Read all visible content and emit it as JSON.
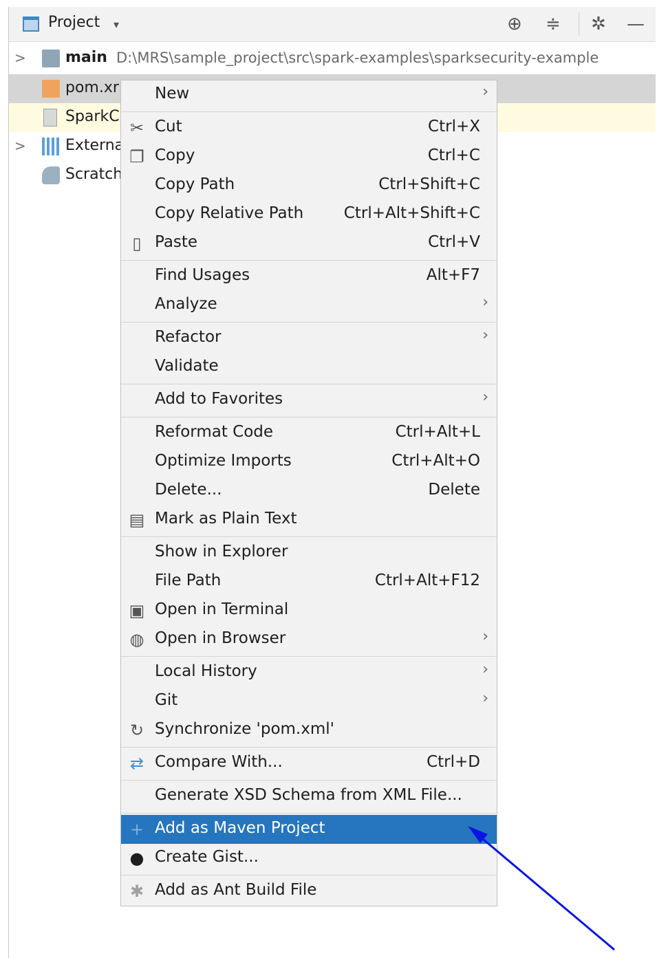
{
  "panel": {
    "title": "Project",
    "caret": "▾",
    "icons": [
      "target-icon",
      "collapse-all-icon",
      "gear-icon",
      "minimize-icon"
    ]
  },
  "tree": {
    "main": {
      "label": "main",
      "path": "D:\\MRS\\sample_project\\src\\spark-examples\\sparksecurity-example"
    },
    "pom": {
      "label": "pom.xr"
    },
    "spark": {
      "label": "SparkC"
    },
    "external": {
      "label": "Externa"
    },
    "scratch": {
      "label": "Scratch"
    }
  },
  "menu": {
    "items": [
      {
        "label": "New",
        "shortcut": "",
        "submenu": true,
        "icon": ""
      },
      {
        "label": "Cut",
        "shortcut": "Ctrl+X",
        "submenu": false,
        "icon": "scissors-icon"
      },
      {
        "label": "Copy",
        "shortcut": "Ctrl+C",
        "submenu": false,
        "icon": "copy-icon"
      },
      {
        "label": "Copy Path",
        "shortcut": "Ctrl+Shift+C",
        "submenu": false,
        "icon": ""
      },
      {
        "label": "Copy Relative Path",
        "shortcut": "Ctrl+Alt+Shift+C",
        "submenu": false,
        "icon": ""
      },
      {
        "label": "Paste",
        "shortcut": "Ctrl+V",
        "submenu": false,
        "icon": "clipboard-icon"
      },
      {
        "label": "Find Usages",
        "shortcut": "Alt+F7",
        "submenu": false,
        "icon": ""
      },
      {
        "label": "Analyze",
        "shortcut": "",
        "submenu": true,
        "icon": ""
      },
      {
        "label": "Refactor",
        "shortcut": "",
        "submenu": true,
        "icon": ""
      },
      {
        "label": "Validate",
        "shortcut": "",
        "submenu": false,
        "icon": ""
      },
      {
        "label": "Add to Favorites",
        "shortcut": "",
        "submenu": true,
        "icon": ""
      },
      {
        "label": "Reformat Code",
        "shortcut": "Ctrl+Alt+L",
        "submenu": false,
        "icon": ""
      },
      {
        "label": "Optimize Imports",
        "shortcut": "Ctrl+Alt+O",
        "submenu": false,
        "icon": ""
      },
      {
        "label": "Delete...",
        "shortcut": "Delete",
        "submenu": false,
        "icon": ""
      },
      {
        "label": "Mark as Plain Text",
        "shortcut": "",
        "submenu": false,
        "icon": "plain-text-icon"
      },
      {
        "label": "Show in Explorer",
        "shortcut": "",
        "submenu": false,
        "icon": ""
      },
      {
        "label": "File Path",
        "shortcut": "Ctrl+Alt+F12",
        "submenu": false,
        "icon": ""
      },
      {
        "label": "Open in Terminal",
        "shortcut": "",
        "submenu": false,
        "icon": "terminal-icon"
      },
      {
        "label": "Open in Browser",
        "shortcut": "",
        "submenu": true,
        "icon": "globe-icon"
      },
      {
        "label": "Local History",
        "shortcut": "",
        "submenu": true,
        "icon": ""
      },
      {
        "label": "Git",
        "shortcut": "",
        "submenu": true,
        "icon": ""
      },
      {
        "label": "Synchronize 'pom.xml'",
        "shortcut": "",
        "submenu": false,
        "icon": "sync-icon"
      },
      {
        "label": "Compare With...",
        "shortcut": "Ctrl+D",
        "submenu": false,
        "icon": "compare-icon"
      },
      {
        "label": "Generate XSD Schema from XML File...",
        "shortcut": "",
        "submenu": false,
        "icon": ""
      },
      {
        "label": "Add as Maven Project",
        "shortcut": "",
        "submenu": false,
        "icon": "plus-icon",
        "selected": true
      },
      {
        "label": "Create Gist...",
        "shortcut": "",
        "submenu": false,
        "icon": "github-icon"
      },
      {
        "label": "Add as Ant Build File",
        "shortcut": "",
        "submenu": false,
        "icon": "ant-icon"
      }
    ]
  },
  "annotation": {
    "color": "#0a14e6"
  }
}
